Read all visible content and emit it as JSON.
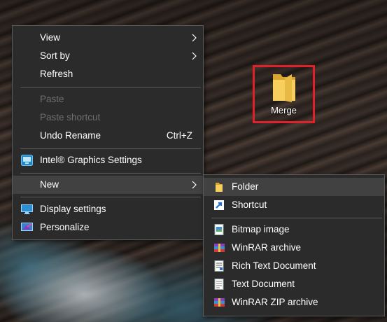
{
  "desktop": {
    "icon": {
      "label": "Merge",
      "icon": "folder-icon"
    }
  },
  "context_menu": {
    "items": [
      {
        "label": "View",
        "submenu": true
      },
      {
        "label": "Sort by",
        "submenu": true
      },
      {
        "label": "Refresh"
      },
      {
        "label": "Paste",
        "disabled": true
      },
      {
        "label": "Paste shortcut",
        "disabled": true
      },
      {
        "label": "Undo Rename",
        "shortcut": "Ctrl+Z"
      },
      {
        "label": "Intel® Graphics Settings",
        "icon": "intel-graphics-icon"
      },
      {
        "label": "New",
        "submenu": true,
        "highlighted": true
      },
      {
        "label": "Display settings",
        "icon": "display-icon"
      },
      {
        "label": "Personalize",
        "icon": "personalize-icon"
      }
    ]
  },
  "new_submenu": {
    "items": [
      {
        "label": "Folder",
        "icon": "folder-icon",
        "highlighted": true
      },
      {
        "label": "Shortcut",
        "icon": "shortcut-icon"
      },
      {
        "label": "Bitmap image",
        "icon": "bitmap-icon"
      },
      {
        "label": "WinRAR archive",
        "icon": "winrar-icon"
      },
      {
        "label": "Rich Text Document",
        "icon": "rich-text-icon"
      },
      {
        "label": "Text Document",
        "icon": "text-document-icon"
      },
      {
        "label": "WinRAR ZIP archive",
        "icon": "winrar-zip-icon"
      }
    ]
  },
  "colors": {
    "menu_bg": "#2b2b2b",
    "menu_hover": "#414141",
    "selection_border": "#e0212b",
    "folder_yellow": "#f3c54a"
  }
}
